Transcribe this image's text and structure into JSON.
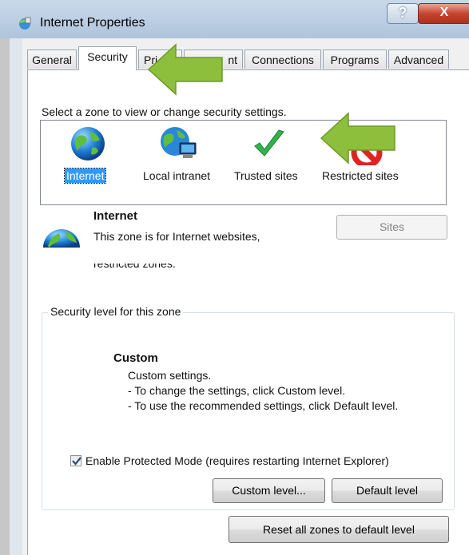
{
  "window": {
    "title": "Internet Properties",
    "help_label": "?",
    "close_label": "X"
  },
  "tabs": [
    {
      "label": "General"
    },
    {
      "label": "Security",
      "active": true
    },
    {
      "label": "Pri"
    },
    {
      "label": "nt"
    },
    {
      "label": "Connections"
    },
    {
      "label": "Programs"
    },
    {
      "label": "Advanced"
    }
  ],
  "zones": {
    "prompt": "Select a zone to view or change security settings.",
    "items": [
      {
        "label": "Internet",
        "icon": "globe-icon",
        "selected": true
      },
      {
        "label": "Local intranet",
        "icon": "intranet-globe-icon"
      },
      {
        "label": "Trusted sites",
        "icon": "checkmark-icon"
      },
      {
        "label": "Restricted sites",
        "icon": "no-entry-icon"
      }
    ]
  },
  "zone_info": {
    "title": "Internet",
    "description": "This zone is for Internet websites,",
    "description_cut": "restricted zones.",
    "sites_button": "Sites"
  },
  "security_level": {
    "legend": "Security level for this zone",
    "level_name": "Custom",
    "level_description": "Custom settings.\n- To change the settings, click Custom level.\n- To use the recommended settings, click Default level.",
    "protected_mode_label": "Enable Protected Mode (requires restarting Internet Explorer)",
    "protected_mode_checked": true,
    "custom_level_button": "Custom level...",
    "default_level_button": "Default level"
  },
  "reset_button": "Reset all zones to default level",
  "colors": {
    "accent": "#3399ff",
    "arrow": "#8dbe3c",
    "close": "#c7442f"
  }
}
